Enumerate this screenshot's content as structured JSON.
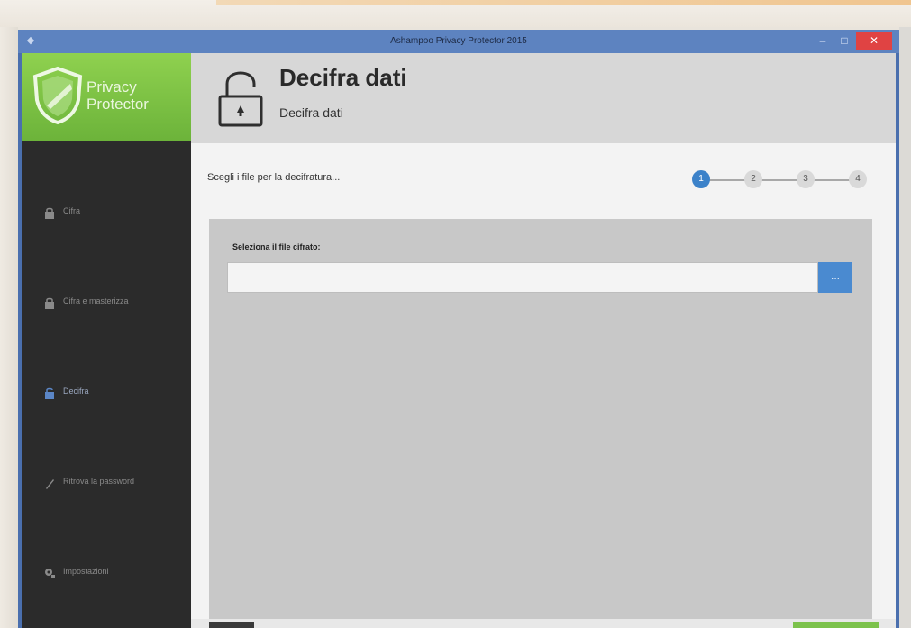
{
  "window": {
    "title": "Ashampoo Privacy Protector 2015",
    "controls": {
      "minimize": "–",
      "maximize": "□",
      "close": "✕"
    }
  },
  "sidebar": {
    "brand": {
      "line1": "Privacy",
      "line2": "Protector"
    },
    "items": [
      {
        "label": "Cifra",
        "icon": "lock-icon",
        "active": false
      },
      {
        "label": "Cifra e masterizza",
        "icon": "lock-disc-icon",
        "active": false
      },
      {
        "label": "Decifra",
        "icon": "unlock-icon",
        "active": true
      },
      {
        "label": "Ritrova la password",
        "icon": "pen-icon",
        "active": false
      },
      {
        "label": "Impostazioni",
        "icon": "gear-icon",
        "active": false
      }
    ]
  },
  "header": {
    "title": "Decifra dati",
    "subtitle": "Decifra dati"
  },
  "wizard": {
    "instruction": "Scegli i file per la decifratura...",
    "steps": [
      "1",
      "2",
      "3",
      "4"
    ],
    "current_step": 1
  },
  "file_panel": {
    "label": "Seleziona il file cifrato:",
    "input_value": "",
    "browse_label": "..."
  },
  "colors": {
    "accent_green": "#7cc24c",
    "accent_blue": "#3c82c9",
    "sidebar_bg": "#2b2b2b"
  }
}
